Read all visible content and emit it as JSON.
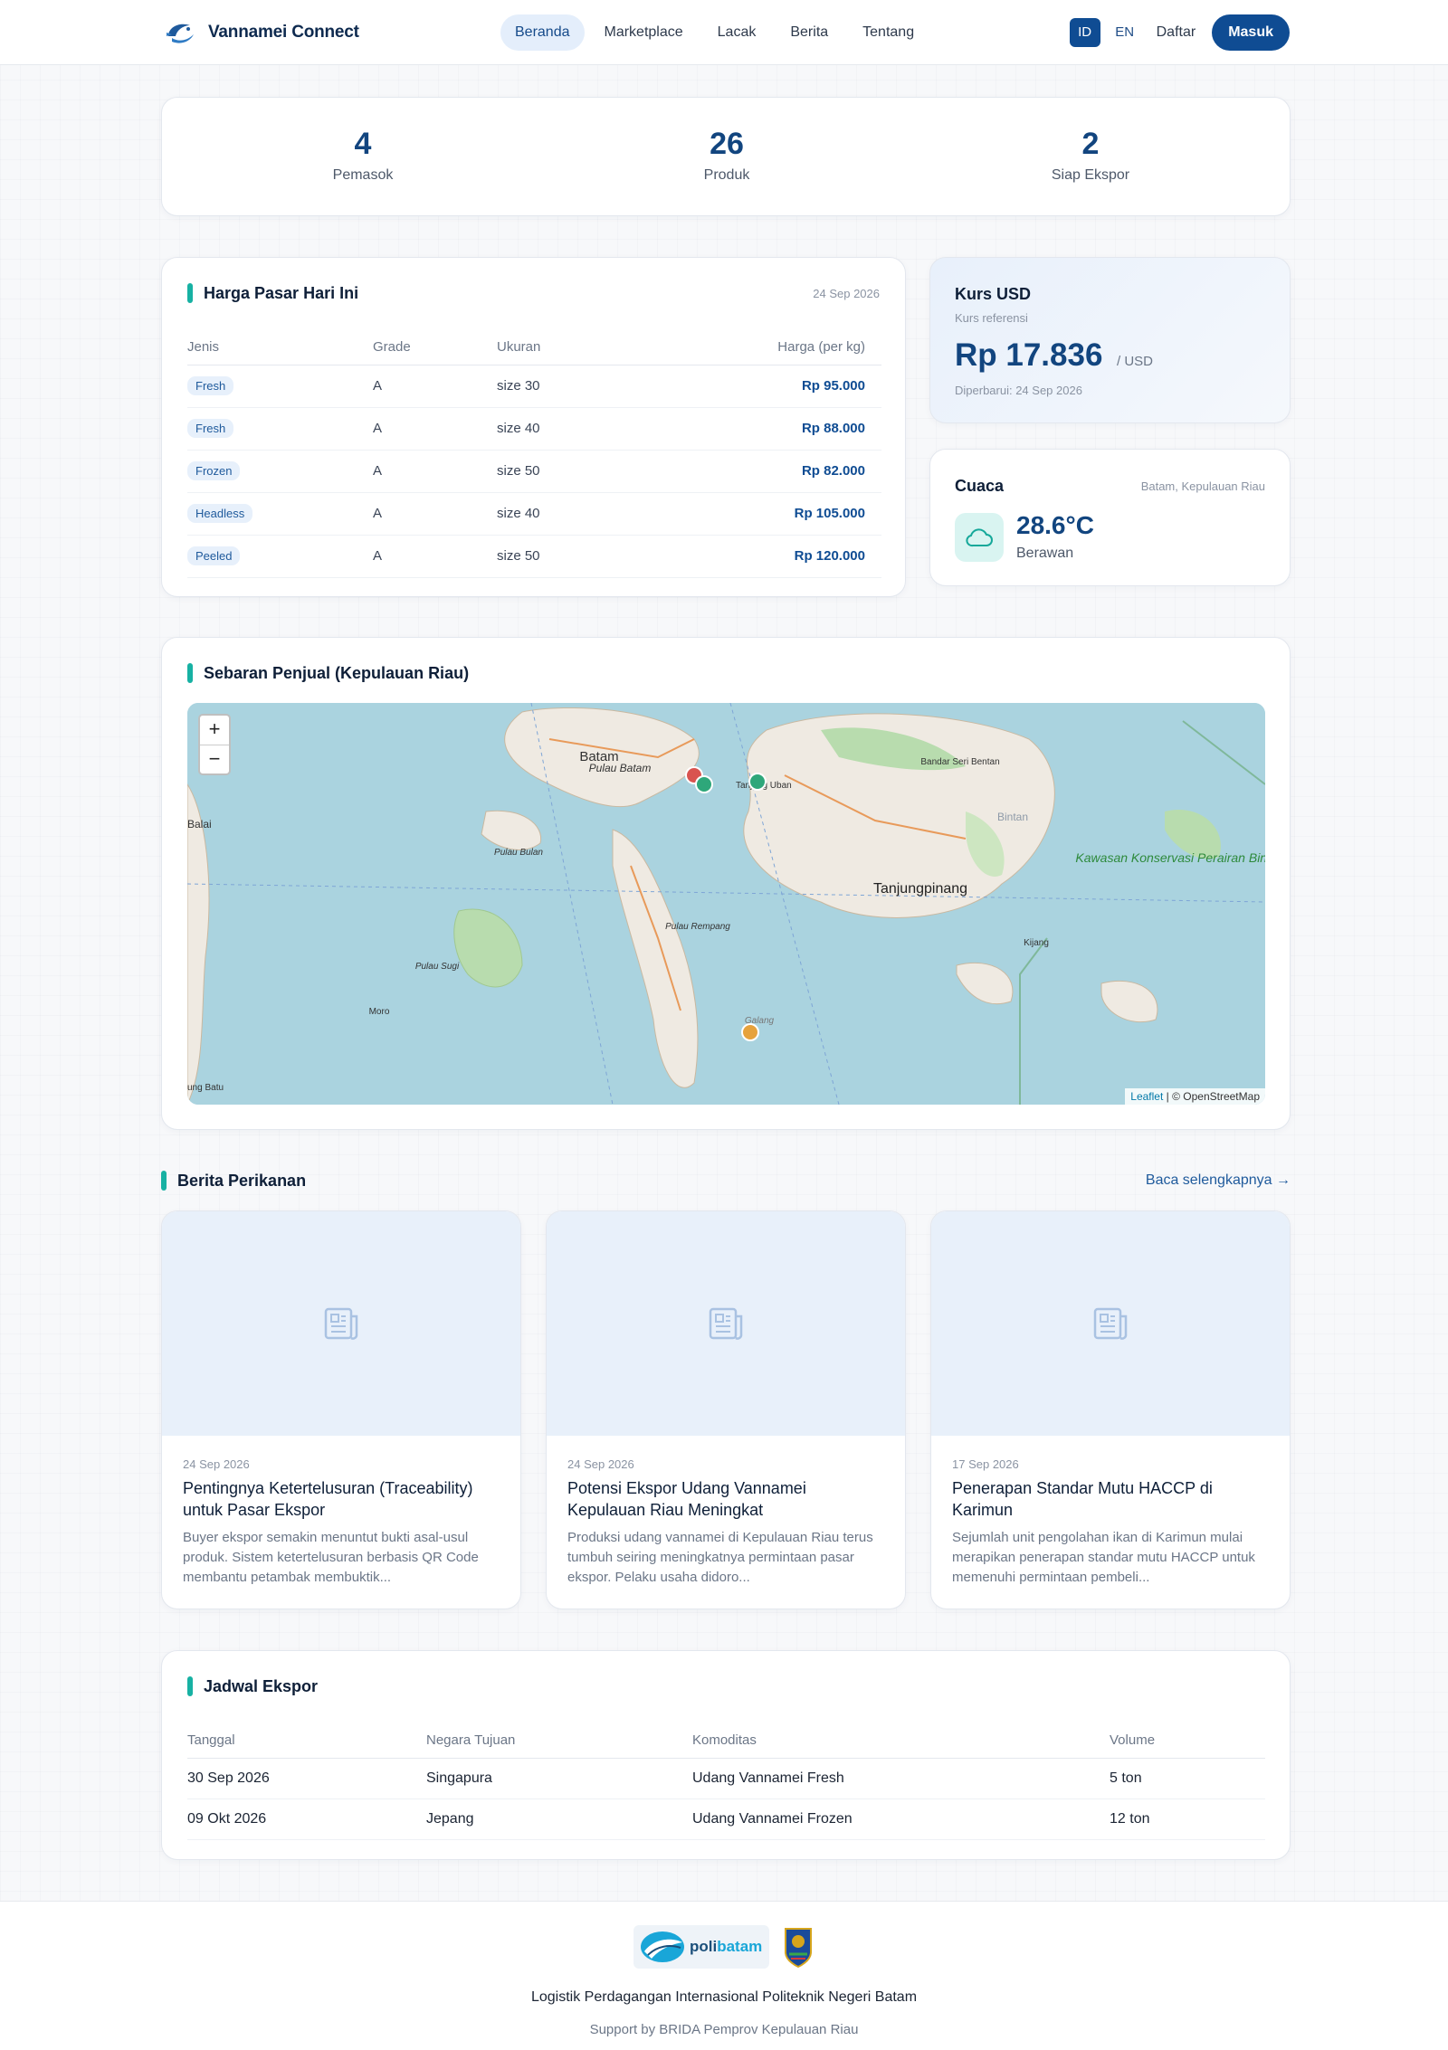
{
  "nav": {
    "brand": "Vannamei Connect",
    "menu": [
      "Beranda",
      "Marketplace",
      "Lacak",
      "Berita",
      "Tentang"
    ],
    "lang_id": "ID",
    "lang_en": "EN",
    "daftar": "Daftar",
    "masuk": "Masuk"
  },
  "stats": [
    {
      "value": "4",
      "label": "Pemasok"
    },
    {
      "value": "26",
      "label": "Produk"
    },
    {
      "value": "2",
      "label": "Siap Ekspor"
    }
  ],
  "price": {
    "title": "Harga Pasar Hari Ini",
    "date": "24 Sep 2026",
    "headers": [
      "Jenis",
      "Grade",
      "Ukuran",
      "Harga (per kg)"
    ],
    "rows": [
      {
        "jenis": "Fresh",
        "grade": "A",
        "ukuran": "size 30",
        "harga": "Rp 95.000"
      },
      {
        "jenis": "Fresh",
        "grade": "A",
        "ukuran": "size 40",
        "harga": "Rp 88.000"
      },
      {
        "jenis": "Frozen",
        "grade": "A",
        "ukuran": "size 50",
        "harga": "Rp 82.000"
      },
      {
        "jenis": "Headless",
        "grade": "A",
        "ukuran": "size 40",
        "harga": "Rp 105.000"
      },
      {
        "jenis": "Peeled",
        "grade": "A",
        "ukuran": "size 50",
        "harga": "Rp 120.000"
      }
    ]
  },
  "kurs": {
    "title": "Kurs USD",
    "sub": "Kurs referensi",
    "value": "Rp 17.836",
    "unit": "/ USD",
    "updated": "Diperbarui: 24 Sep 2026"
  },
  "cuaca": {
    "title": "Cuaca",
    "location": "Batam, Kepulauan Riau",
    "temp": "28.6°C",
    "desc": "Berawan",
    "icon": "cloud-icon"
  },
  "map": {
    "title": "Sebaran Penjual (Kepulauan Riau)",
    "zoom_in": "+",
    "zoom_out": "−",
    "attribution_link": "Leaflet",
    "attribution_rest": " | © OpenStreetMap",
    "labels": [
      "Batam",
      "Pulau Batam",
      "Tanjungpinang",
      "Pulau Bulan",
      "Pulau Rempang",
      "Pulau Sugi",
      "Moro",
      "Galang",
      "Bandar Seri Bentan",
      "Bintan",
      "Kijang",
      "Kawasan Konservasi Perairan Bintan",
      "Balai",
      "Tanjung Uban",
      "ung Batu"
    ],
    "marker_colors": [
      "#d9534f",
      "#2ea77a",
      "#2ea77a",
      "#e6a23c"
    ]
  },
  "news": {
    "title": "Berita Perikanan",
    "more": "Baca selengkapnya →",
    "items": [
      {
        "date": "24 Sep 2026",
        "title": "Pentingnya Ketertelusuran (Traceability) untuk Pasar Ekspor",
        "excerpt": "Buyer ekspor semakin menuntut bukti asal-usul produk. Sistem ketertelusuran berbasis QR Code membantu petambak membuktik..."
      },
      {
        "date": "24 Sep 2026",
        "title": "Potensi Ekspor Udang Vannamei Kepulauan Riau Meningkat",
        "excerpt": "Produksi udang vannamei di Kepulauan Riau terus tumbuh seiring meningkatnya permintaan pasar ekspor. Pelaku usaha didoro..."
      },
      {
        "date": "17 Sep 2026",
        "title": "Penerapan Standar Mutu HACCP di Karimun",
        "excerpt": "Sejumlah unit pengolahan ikan di Karimun mulai merapikan penerapan standar mutu HACCP untuk memenuhi permintaan pembeli..."
      }
    ]
  },
  "schedule": {
    "title": "Jadwal Ekspor",
    "headers": [
      "Tanggal",
      "Negara Tujuan",
      "Komoditas",
      "Volume"
    ],
    "rows": [
      {
        "tanggal": "30 Sep 2026",
        "negara": "Singapura",
        "komoditas": "Udang Vannamei Fresh",
        "volume": "5 ton"
      },
      {
        "tanggal": "09 Okt 2026",
        "negara": "Jepang",
        "komoditas": "Udang Vannamei Frozen",
        "volume": "12 ton"
      }
    ]
  },
  "footer": {
    "logo_text_a": "poli",
    "logo_text_b": "batam",
    "line1": "Logistik Perdagangan Internasional Politeknik Negeri Batam",
    "line2": "Support by BRIDA Pemprov Kepulauan Riau"
  }
}
